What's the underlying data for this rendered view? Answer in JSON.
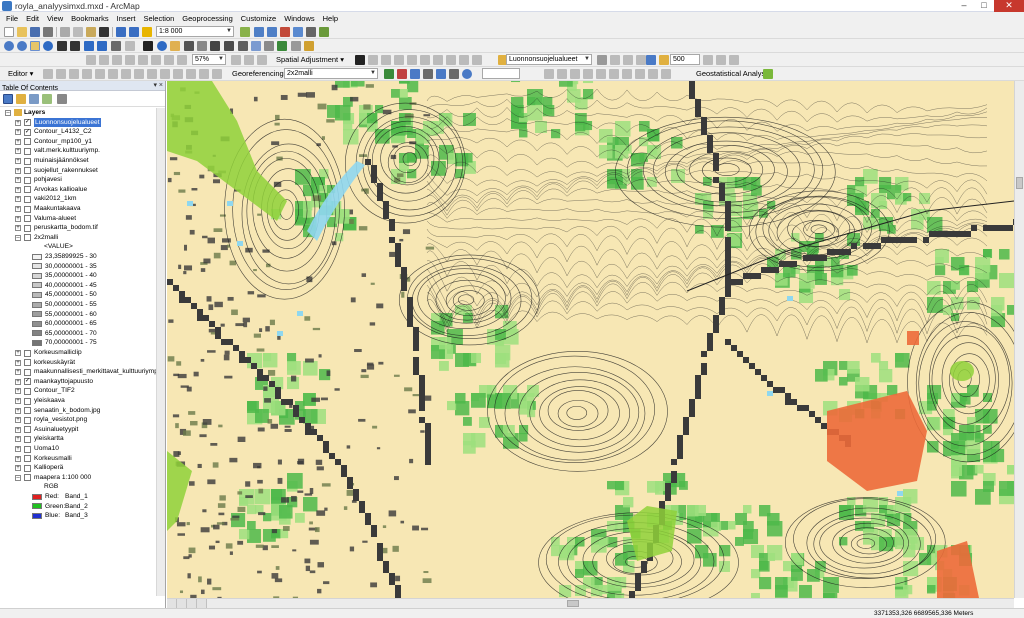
{
  "window": {
    "title": "royla_analyysimxd.mxd - ArcMap"
  },
  "menu": [
    "File",
    "Edit",
    "View",
    "Bookmarks",
    "Insert",
    "Selection",
    "Geoprocessing",
    "Customize",
    "Windows",
    "Help"
  ],
  "toolbar": {
    "scale": "1:8 000",
    "zoom_percent": "57%",
    "spatial_adjustment": "Spatial Adjustment",
    "active_layer": "Luonnonsuojelualueet",
    "search_value": "500",
    "editor": "Editor",
    "georeferencing": "Georeferencing",
    "georef_layer": "2x2malli",
    "geostatistical": "Geostatistical Analyst"
  },
  "toc": {
    "title": "Table Of Contents",
    "root": "Layers",
    "layers": [
      {
        "name": "Luonnonsuojelualueet",
        "checked": true,
        "selected": true
      },
      {
        "name": "Contour_L4132_C2",
        "checked": true
      },
      {
        "name": "Contour_mp100_y1",
        "checked": false
      },
      {
        "name": "valt.merk.kulttuuriymp.",
        "checked": false
      },
      {
        "name": "muinaisjäännökset",
        "checked": false
      },
      {
        "name": "suojellut_rakennukset",
        "checked": false
      },
      {
        "name": "pohjavesi",
        "checked": false
      },
      {
        "name": "Arvokas kallioalue",
        "checked": false
      },
      {
        "name": "vaki2012_1km",
        "checked": false
      },
      {
        "name": "Maakuntakaava",
        "checked": false
      },
      {
        "name": "Valuma-alueet",
        "checked": false
      },
      {
        "name": "peruskartta_bodom.tif",
        "checked": false
      },
      {
        "name": "2x2malli",
        "checked": false,
        "expanded": true
      }
    ],
    "value_header": "<VALUE>",
    "value_classes": [
      {
        "label": "23,35899925 - 30",
        "color": "#f2f2f2"
      },
      {
        "label": "30,00000001 - 35",
        "color": "#e4e4e4"
      },
      {
        "label": "35,00000001 - 40",
        "color": "#d6d6d6"
      },
      {
        "label": "40,00000001 - 45",
        "color": "#c8c8c8"
      },
      {
        "label": "45,00000001 - 50",
        "color": "#bababa"
      },
      {
        "label": "50,00000001 - 55",
        "color": "#acacac"
      },
      {
        "label": "55,00000001 - 60",
        "color": "#9e9e9e"
      },
      {
        "label": "60,00000001 - 65",
        "color": "#909090"
      },
      {
        "label": "65,00000001 - 70",
        "color": "#828282"
      },
      {
        "label": "70,00000001 - 75",
        "color": "#747474"
      }
    ],
    "layers_after": [
      {
        "name": "Korkeusmalliclip",
        "checked": false
      },
      {
        "name": "korkeuskäyrät",
        "checked": false
      },
      {
        "name": "maakunnallisesti_merkittavat_kulttuuriymp.tif",
        "checked": false
      },
      {
        "name": "maankayttojapuusto",
        "checked": true
      },
      {
        "name": "Contour_TIF2",
        "checked": false
      },
      {
        "name": "yleiskaava",
        "checked": false
      },
      {
        "name": "senaatin_k_bodom.jpg",
        "checked": false
      },
      {
        "name": "royla_vesistot.png",
        "checked": false
      },
      {
        "name": "Asuinaluetyypit",
        "checked": false
      },
      {
        "name": "yleiskartta",
        "checked": false
      },
      {
        "name": "Uoma10",
        "checked": false
      },
      {
        "name": "Korkeusmalli",
        "checked": false
      },
      {
        "name": "Kallioperä",
        "checked": false
      },
      {
        "name": "maapera 1:100 000",
        "checked": false,
        "expanded": true
      }
    ],
    "rgb_header": "RGB",
    "rgb_bands": [
      {
        "label": "Red:",
        "band": "Band_1",
        "color": "#e02020"
      },
      {
        "label": "Green:",
        "band": "Band_2",
        "color": "#20c020"
      },
      {
        "label": "Blue:",
        "band": "Band_3",
        "color": "#2030d0"
      }
    ]
  },
  "status": {
    "coordinates": "3371353,326  6689565,336 Meters"
  },
  "colors": {
    "map_background": "#f7e7b4",
    "protected_area": "#8fd13a",
    "forest_green": "#4db84a",
    "light_green": "#9edf7e",
    "contour": "#1a1a1a",
    "dem_dark": "#3a3a3a",
    "orange": "#ec6a3a",
    "water": "#8fd7ef"
  }
}
